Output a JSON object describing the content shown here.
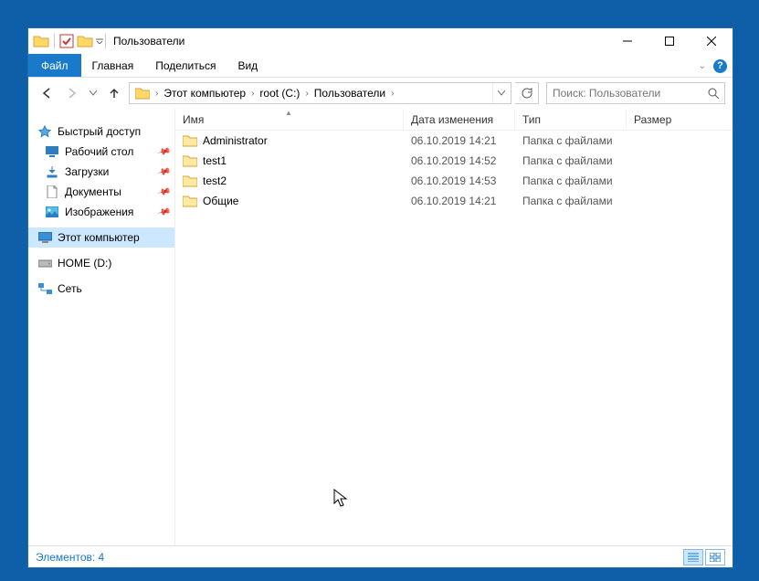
{
  "window": {
    "title": "Пользователи"
  },
  "tabs": {
    "file": "Файл",
    "home": "Главная",
    "share": "Поделиться",
    "view": "Вид"
  },
  "nav": {
    "back": "←",
    "forward": "→",
    "up": "↑"
  },
  "breadcrumbs": [
    {
      "label": "Этот компьютер"
    },
    {
      "label": "root (C:)"
    },
    {
      "label": "Пользователи"
    }
  ],
  "search": {
    "placeholder": "Поиск: Пользователи"
  },
  "sidebar": {
    "quick_access": "Быстрый доступ",
    "items": [
      {
        "label": "Рабочий стол"
      },
      {
        "label": "Загрузки"
      },
      {
        "label": "Документы"
      },
      {
        "label": "Изображения"
      }
    ],
    "this_pc": "Этот компьютер",
    "drive": "HOME (D:)",
    "network": "Сеть"
  },
  "columns": {
    "name": "Имя",
    "date": "Дата изменения",
    "type": "Тип",
    "size": "Размер"
  },
  "rows": [
    {
      "name": "Administrator",
      "date": "06.10.2019 14:21",
      "type": "Папка с файлами",
      "size": ""
    },
    {
      "name": "test1",
      "date": "06.10.2019 14:52",
      "type": "Папка с файлами",
      "size": ""
    },
    {
      "name": "test2",
      "date": "06.10.2019 14:53",
      "type": "Папка с файлами",
      "size": ""
    },
    {
      "name": "Общие",
      "date": "06.10.2019 14:21",
      "type": "Папка с файлами",
      "size": ""
    }
  ],
  "status": {
    "text": "Элементов: 4"
  }
}
